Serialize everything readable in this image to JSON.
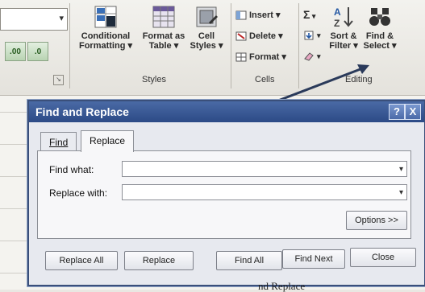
{
  "ribbon": {
    "conditional_formatting": "Conditional Formatting ▾",
    "format_as_table": "Format as Table ▾",
    "cell_styles": "Cell Styles ▾",
    "styles_group": "Styles",
    "insert": "Insert ▾",
    "delete": "Delete ▾",
    "format": "Format ▾",
    "cells_group": "Cells",
    "sort_filter": "Sort & Filter ▾",
    "find_select": "Find & Select ▾",
    "editing_group": "Editing",
    "decrease_decimal": ".00",
    "increase_decimal": ".0"
  },
  "dialog": {
    "title": "Find and Replace",
    "help_button": "?",
    "close_button": "X",
    "tabs": [
      {
        "label": "Find",
        "active": false
      },
      {
        "label": "Replace",
        "active": true
      }
    ],
    "find_what_label": "Find what:",
    "find_what_value": "",
    "replace_with_label": "Replace with:",
    "replace_with_value": "",
    "options_button": "Options >>",
    "buttons": {
      "replace_all": "Replace All",
      "replace": "Replace",
      "find_all": "Find All",
      "find_next": "Find Next",
      "close": "Close"
    }
  },
  "caption_partial": "nd Replace"
}
